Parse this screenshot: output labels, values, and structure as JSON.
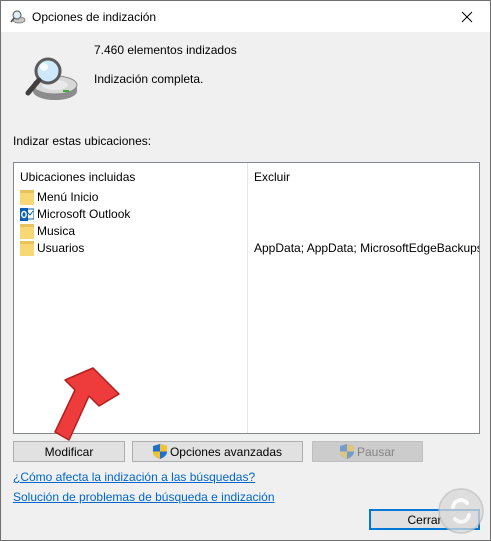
{
  "window": {
    "title": "Opciones de indización",
    "close_glyph": "✕"
  },
  "status": {
    "items_indexed": "7.460 elementos indizados",
    "message": "Indización completa."
  },
  "locations": {
    "section_label": "Indizar estas ubicaciones:",
    "columns": {
      "included": "Ubicaciones incluidas",
      "exclude": "Excluir"
    },
    "rows": [
      {
        "name": "Menú Inicio",
        "exclude": "",
        "icon": "folder-icon"
      },
      {
        "name": "Microsoft Outlook",
        "exclude": "",
        "icon": "outlook-icon"
      },
      {
        "name": "Musica",
        "exclude": "",
        "icon": "folder-icon"
      },
      {
        "name": "Usuarios",
        "exclude": "AppData; AppData; MicrosoftEdgeBackups",
        "icon": "folder-icon"
      }
    ]
  },
  "buttons": {
    "modify": "Modificar",
    "advanced": "Opciones avanzadas",
    "pause": "Pausar",
    "close": "Cerrar"
  },
  "links": {
    "how_indexing_affects": "¿Cómo afecta la indización a las búsquedas?",
    "troubleshoot": "Solución de problemas de búsqueda e indización"
  },
  "colors": {
    "link": "#0066cc",
    "annotation_arrow": "#ee3b3b",
    "default_button_border": "#0078d7",
    "folder": "#f8d775"
  }
}
